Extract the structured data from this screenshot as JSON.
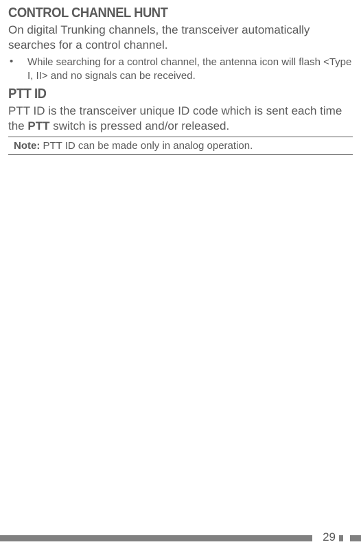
{
  "section1": {
    "heading": "CONTROL CHANNEL HUNT",
    "paragraph": "On digital Trunking channels, the transceiver automatically searches for a control channel.",
    "bullet": "While searching for a control channel, the antenna icon will flash <Type I, II> and no signals can be received."
  },
  "section2": {
    "heading": "PTT ID",
    "paragraph_pre": "PTT ID is the transceiver unique ID code which is sent each time the ",
    "paragraph_bold": "PTT",
    "paragraph_post": " switch is pressed and/or released.",
    "note_label": "Note:",
    "note_text": "  PTT ID can be made only in analog operation."
  },
  "footer": {
    "page_number": "29"
  }
}
